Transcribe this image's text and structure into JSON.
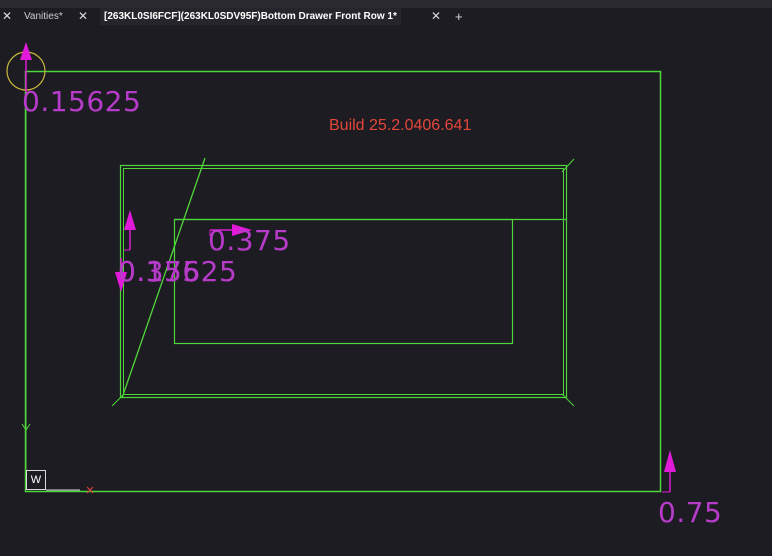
{
  "tabs": [
    {
      "label": "Vanities*",
      "active": false
    },
    {
      "label": "[263KL0SI6FCF](263KL0SDV95F)Bottom Drawer Front Row 1*",
      "active": true
    }
  ],
  "tab_close_glyph": "✕",
  "tab_add_glyph": "+",
  "build_text": "Build 25.2.0406.641",
  "dimensions": {
    "top_left": "0.15625",
    "inner_horizontal": "0.375",
    "inner_overlap_a": "0.375",
    "inner_overlap_b": "0.15625",
    "bottom_right": "0.75"
  },
  "ucs_icon_label": "W",
  "colors": {
    "background": "#1d1c22",
    "geometry": "#4fd63a",
    "dimension": "#b63bc9",
    "arrow": "#e11ad9",
    "build_text": "#e5463a",
    "cursor_circle": "#c9b83a",
    "axis_x_marker": "#d8433c"
  }
}
